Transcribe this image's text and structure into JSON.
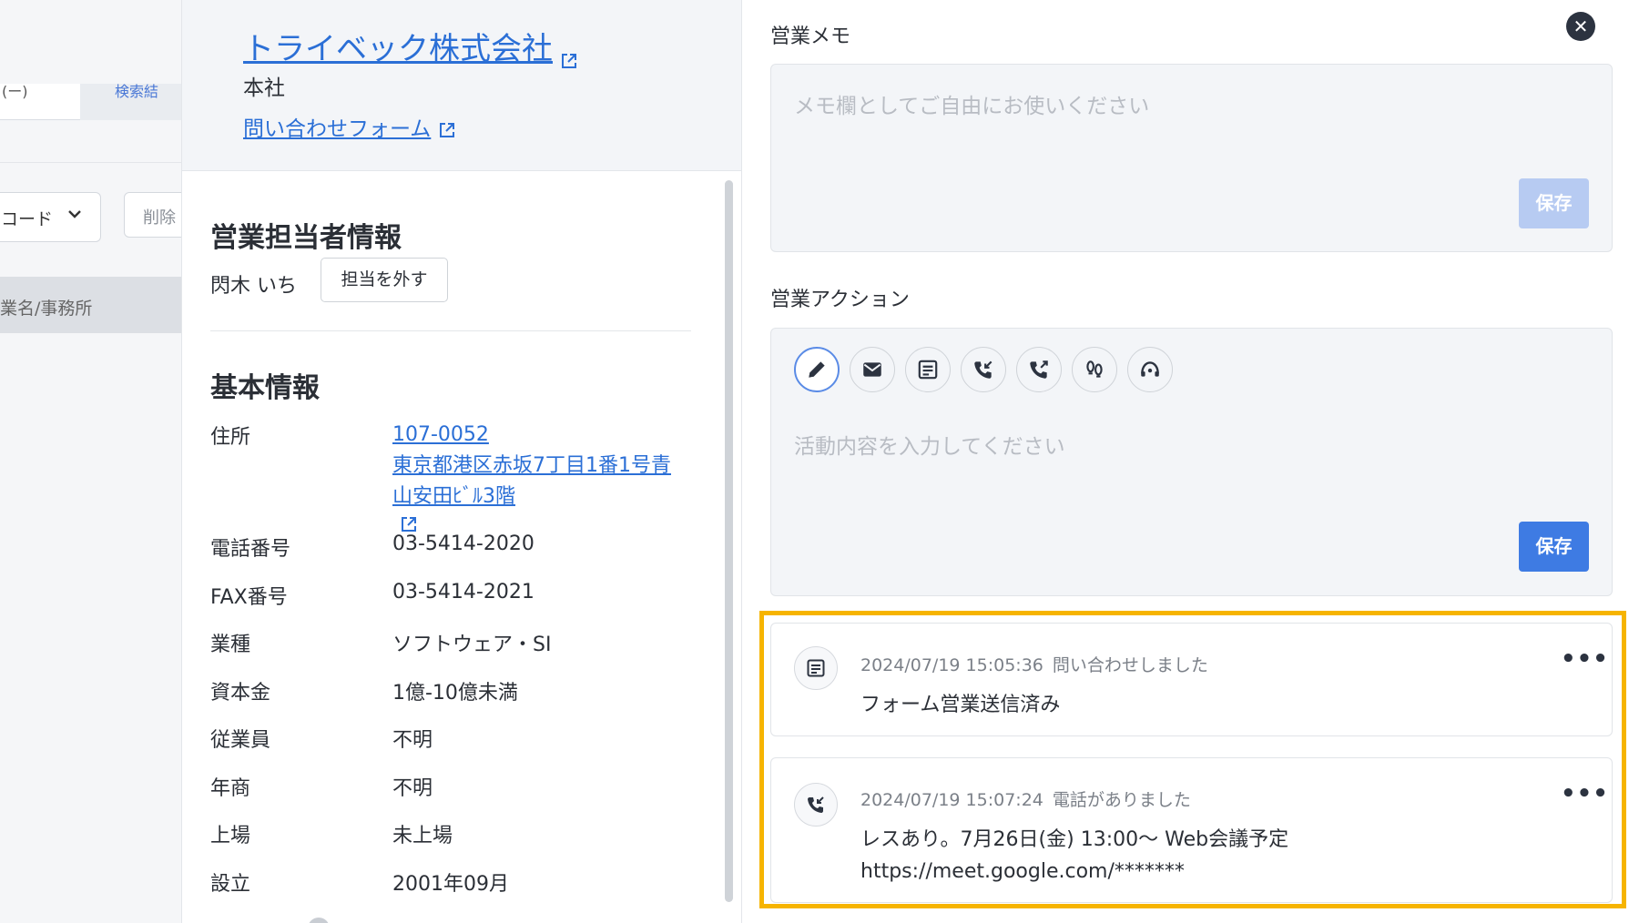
{
  "background_list": {
    "tab_a": "(ー)",
    "tab_b": "検索結",
    "select_value": "コード",
    "delete_label": "削除",
    "column_header": "業名/事務所"
  },
  "company": {
    "name": "トライベック株式会社",
    "branch": "本社",
    "contact_form_label": "問い合わせフォーム"
  },
  "sales_rep": {
    "section_title": "営業担当者情報",
    "name": "閃木 いち",
    "remove_label": "担当を外す"
  },
  "basic_info": {
    "section_title": "基本情報",
    "address_label": "住所",
    "postal_code": "107-0052",
    "address_line1": "東京都港区赤坂7丁目1番1号青",
    "address_line2": "山安田ﾋﾞﾙ3階",
    "rows": [
      {
        "label": "電話番号",
        "value": "03-5414-2020"
      },
      {
        "label": "FAX番号",
        "value": "03-5414-2021"
      },
      {
        "label": "業種",
        "value": "ソフトウェア・SI"
      },
      {
        "label": "資本金",
        "value": "1億-10億未満"
      },
      {
        "label": "従業員",
        "value": "不明"
      },
      {
        "label": "年商",
        "value": "不明"
      },
      {
        "label": "上場",
        "value": "未上場"
      },
      {
        "label": "設立",
        "value": "2001年09月"
      }
    ]
  },
  "memo": {
    "title": "営業メモ",
    "placeholder": "メモ欄としてご自由にお使いください",
    "save_label": "保存"
  },
  "action": {
    "title": "営業アクション",
    "placeholder": "活動内容を入力してください",
    "save_label": "保存",
    "icons": [
      "pencil-icon",
      "mail-icon",
      "form-icon",
      "incoming-call-icon",
      "outgoing-call-icon",
      "visit-icon",
      "support-icon"
    ]
  },
  "activities": [
    {
      "timestamp": "2024/07/19 15:05:36",
      "type": "問い合わせしました",
      "body_lines": [
        "フォーム営業送信済み"
      ],
      "icon": "form-icon"
    },
    {
      "timestamp": "2024/07/19 15:07:24",
      "type": "電話がありました",
      "body_lines": [
        "レスあり。7月26日(金) 13:00〜 Web会議予定",
        "https://meet.google.com/*******"
      ],
      "icon": "incoming-call-icon"
    }
  ],
  "close_label": "✕",
  "more_label": "•••",
  "colors": {
    "accent": "#3e7be3",
    "link": "#2b6fd6",
    "highlight": "#f6b400"
  }
}
